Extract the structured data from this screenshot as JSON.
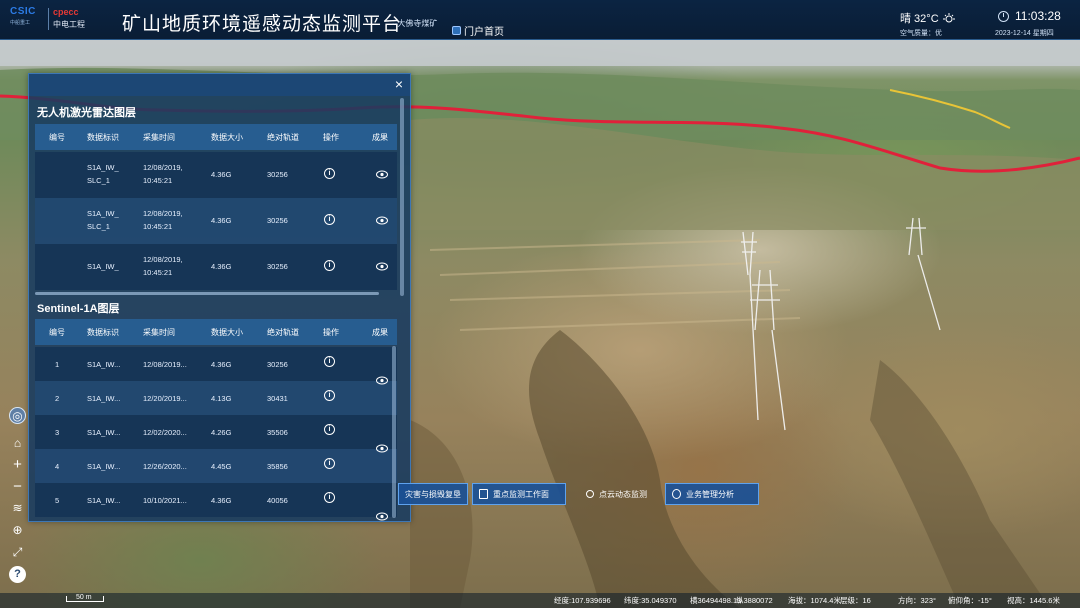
{
  "header": {
    "logo_primary": "CSIC",
    "logo_primary_sub": "中船重工",
    "logo_secondary": "cpecc",
    "logo_secondary_sub": "中电工程",
    "title": "矿山地质环境遥感动态监测平台",
    "subtitle": "--大佛寺煤矿",
    "portal_link": "门户首页",
    "weather": "晴 32°C",
    "air_quality": "空气质量：优",
    "time": "11:03:28",
    "date": "2023-12-14 星期四"
  },
  "panel": {
    "section1_title": "无人机激光雷达图层",
    "section2_title": "Sentinel-1A图层",
    "columns": [
      "编号",
      "数据标识",
      "采集时间",
      "数据大小",
      "绝对轨道",
      "操作",
      "成果"
    ],
    "lidar_rows": [
      {
        "id": "",
        "data_id": "S1A_IW_\nSLC_1",
        "time": "12/08/2019,\n10:45:21",
        "size": "4.36G",
        "orbit": "30256"
      },
      {
        "id": "",
        "data_id": "S1A_IW_\nSLC_1",
        "time": "12/08/2019,\n10:45:21",
        "size": "4.36G",
        "orbit": "30256"
      },
      {
        "id": "",
        "data_id": "S1A_IW_",
        "time": "12/08/2019,\n10:45:21",
        "size": "4.36G",
        "orbit": "30256"
      }
    ],
    "sentinel_rows": [
      {
        "id": "1",
        "data_id": "S1A_IW...",
        "time": "12/08/2019...",
        "size": "4.36G",
        "orbit": "30256"
      },
      {
        "id": "2",
        "data_id": "S1A_IW...",
        "time": "12/20/2019...",
        "size": "4.13G",
        "orbit": "30431"
      },
      {
        "id": "3",
        "data_id": "S1A_IW...",
        "time": "12/02/2020...",
        "size": "4.26G",
        "orbit": "35506"
      },
      {
        "id": "4",
        "data_id": "S1A_IW...",
        "time": "12/26/2020...",
        "size": "4.45G",
        "orbit": "35856"
      },
      {
        "id": "5",
        "data_id": "S1A_IW...",
        "time": "10/10/2021...",
        "size": "4.36G",
        "orbit": "40056"
      }
    ]
  },
  "function_buttons": {
    "disaster": "灾害与损毁复垦",
    "key_monitoring": "重点监测工作面",
    "point_cloud": "点云动态监测",
    "business": "业务管理分析"
  },
  "status": {
    "scale": "50 m",
    "longitude": "经度:107.939696",
    "latitude": "纬度:35.049370",
    "x_coord": "横36494498.13",
    "y_coord": "纵3880072",
    "altitude": "海拔：1074.4米",
    "level": "层级：16",
    "heading": "方向：323°",
    "pitch": "俯仰角：-15°",
    "view_height": "视高：1445.6米"
  },
  "icons": {
    "help": "?"
  }
}
